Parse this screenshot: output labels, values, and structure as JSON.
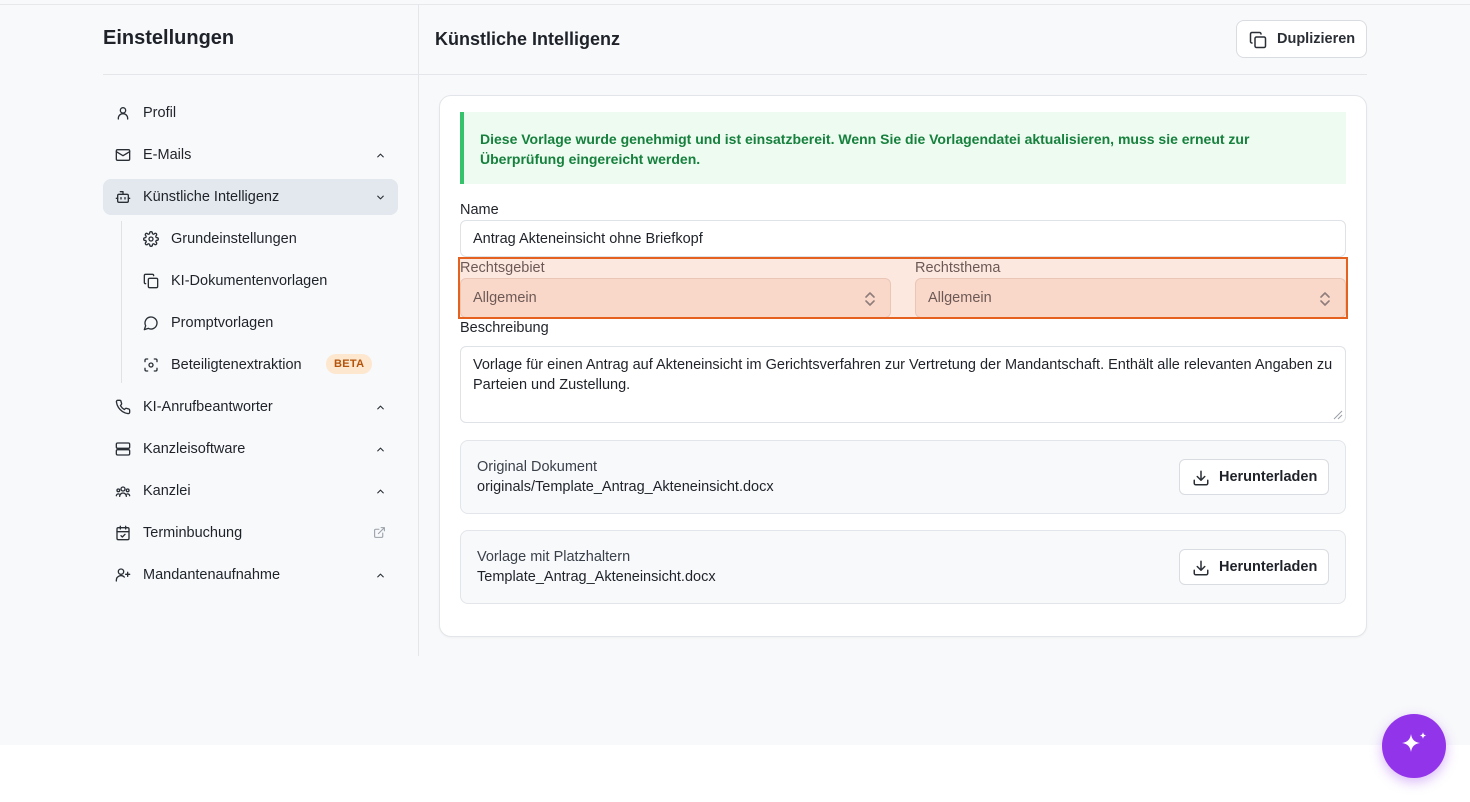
{
  "sidebar": {
    "title": "Einstellungen",
    "items": [
      {
        "label": "Profil",
        "icon": "user-icon"
      },
      {
        "label": "E-Mails",
        "icon": "mail-icon"
      },
      {
        "label": "Künstliche Intelligenz",
        "icon": "bot-icon",
        "active": true
      },
      {
        "label": "KI-Anrufbeantworter",
        "icon": "phone-icon"
      },
      {
        "label": "Kanzleisoftware",
        "icon": "server-icon"
      },
      {
        "label": "Kanzlei",
        "icon": "users-icon"
      },
      {
        "label": "Terminbuchung",
        "icon": "calendar-check-icon"
      },
      {
        "label": "Mandantenaufnahme",
        "icon": "user-plus-icon"
      }
    ],
    "subitems": [
      {
        "label": "Grundeinstellungen",
        "icon": "gear-icon"
      },
      {
        "label": "KI-Dokumentenvorlagen",
        "icon": "copy-icon"
      },
      {
        "label": "Promptvorlagen",
        "icon": "message-circle-icon"
      },
      {
        "label": "Beteiligtenextraktion",
        "icon": "scan-face-icon",
        "badge": "BETA"
      }
    ]
  },
  "header": {
    "title": "Künstliche Intelligenz",
    "duplicate_label": "Duplizieren"
  },
  "alert": {
    "text": "Diese Vorlage wurde genehmigt und ist einsatzbereit. Wenn Sie die Vorlagendatei aktualisieren, muss sie erneut zur Überprüfung eingereicht werden."
  },
  "form": {
    "name_label": "Name",
    "name_value": "Antrag Akteneinsicht ohne Briefkopf",
    "rechtsgebiet_label": "Rechtsgebiet",
    "rechtsgebiet_value": "Allgemein",
    "rechtsthema_label": "Rechtsthema",
    "rechtsthema_value": "Allgemein",
    "beschreibung_label": "Beschreibung",
    "beschreibung_value": "Vorlage für einen Antrag auf Akteneinsicht im Gerichtsverfahren zur Vertretung der Mandantschaft. Enthält alle relevanten Angaben zu Parteien und Zustellung."
  },
  "files": [
    {
      "title": "Original Dokument",
      "filename": "originals/Template_Antrag_Akteneinsicht.docx",
      "button": "Herunterladen"
    },
    {
      "title": "Vorlage mit Platzhaltern",
      "filename": "Template_Antrag_Akteneinsicht.docx",
      "button": "Herunterladen"
    }
  ],
  "colors": {
    "accent_fab": "#9234ea",
    "alert_green": "#16803d",
    "highlight_orange": "#e4611f"
  }
}
